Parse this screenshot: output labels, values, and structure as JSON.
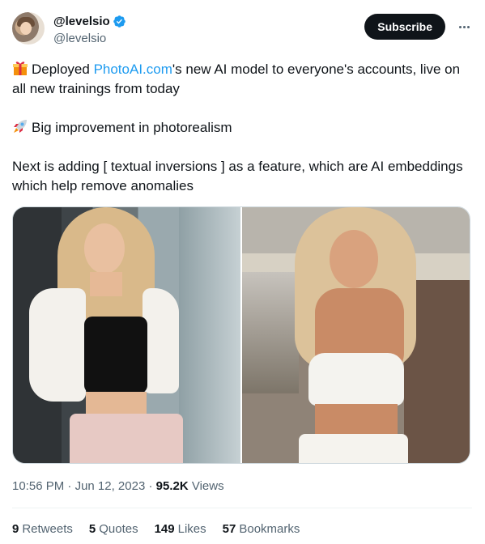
{
  "author": {
    "display_name": "@levelsio",
    "handle": "@levelsio",
    "verified": true,
    "verified_color": "#1d9bf0"
  },
  "header": {
    "subscribe_label": "Subscribe",
    "more_icon": "more-horizontal-icon"
  },
  "tweet": {
    "line1_prefix": "Deployed ",
    "line1_link": "PhotoAI.com",
    "line1_suffix": "'s new AI model to everyone's accounts, live on all new trainings from today",
    "line2": "Big improvement in photorealism",
    "line3": "Next is adding [ textual inversions ] as a feature, which are AI embeddings which help remove anomalies",
    "emoji1": "gift-icon",
    "emoji2": "rocket-icon",
    "link_color": "#1d9bf0"
  },
  "media": {
    "images": [
      "photo-woman-black-top",
      "photo-woman-white-top"
    ]
  },
  "meta": {
    "time": "10:56 PM",
    "separator1": " · ",
    "date": "Jun 12, 2023",
    "separator2": " · ",
    "views_count": "95.2K",
    "views_label": " Views"
  },
  "stats": {
    "retweets_count": "9",
    "retweets_label": "Retweets",
    "quotes_count": "5",
    "quotes_label": "Quotes",
    "likes_count": "149",
    "likes_label": "Likes",
    "bookmarks_count": "57",
    "bookmarks_label": "Bookmarks"
  }
}
